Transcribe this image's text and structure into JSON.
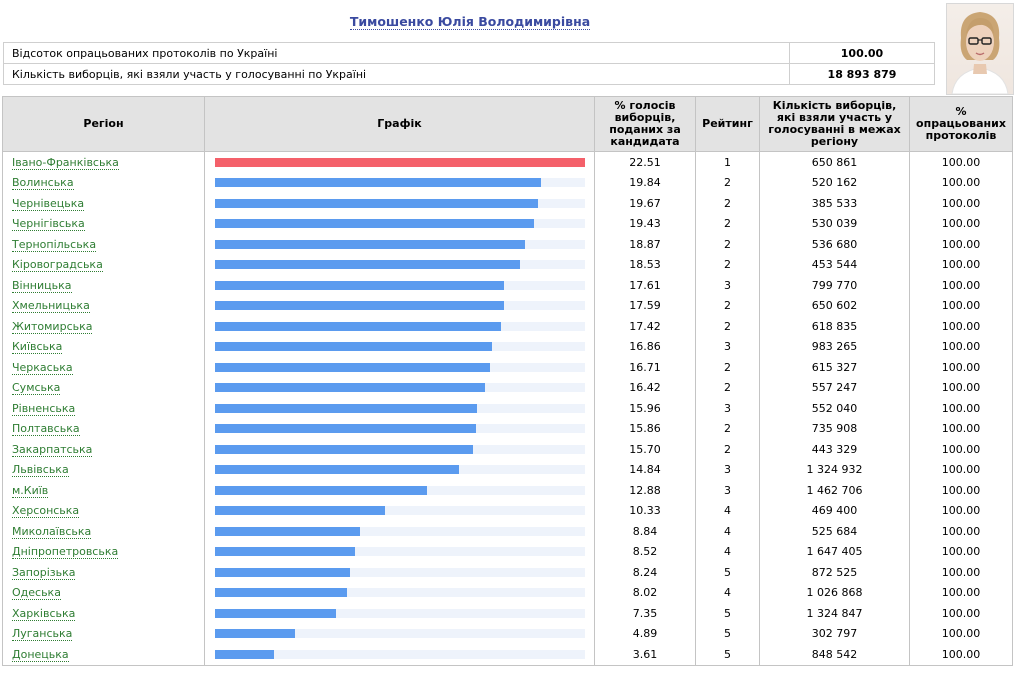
{
  "candidate": {
    "name": "Тимошенко Юлія Володимирівна"
  },
  "summary": [
    {
      "label": "Відсоток опрацьованих протоколів по Україні",
      "value": "100.00"
    },
    {
      "label": "Кількість виборців, які взяли участь у голосуванні по Україні",
      "value": "18 893 879"
    }
  ],
  "table": {
    "headers": {
      "region": "Регіон",
      "chart": "Графік",
      "percent": "% голосів виборців, поданих за кандидата",
      "rating": "Рейтинг",
      "voters": "Кількість виборців, які взяли участь у голосуванні в межах регіону",
      "processed": "% опрацьованих протоколів"
    },
    "rows": [
      {
        "region": "Івано-Франківська",
        "percent": "22.51",
        "rating": "1",
        "voters": "650 861",
        "processed": "100.00"
      },
      {
        "region": "Волинська",
        "percent": "19.84",
        "rating": "2",
        "voters": "520 162",
        "processed": "100.00"
      },
      {
        "region": "Чернівецька",
        "percent": "19.67",
        "rating": "2",
        "voters": "385 533",
        "processed": "100.00"
      },
      {
        "region": "Чернігівська",
        "percent": "19.43",
        "rating": "2",
        "voters": "530 039",
        "processed": "100.00"
      },
      {
        "region": "Тернопільська",
        "percent": "18.87",
        "rating": "2",
        "voters": "536 680",
        "processed": "100.00"
      },
      {
        "region": "Кіровоградська",
        "percent": "18.53",
        "rating": "2",
        "voters": "453 544",
        "processed": "100.00"
      },
      {
        "region": "Вінницька",
        "percent": "17.61",
        "rating": "3",
        "voters": "799 770",
        "processed": "100.00"
      },
      {
        "region": "Хмельницька",
        "percent": "17.59",
        "rating": "2",
        "voters": "650 602",
        "processed": "100.00"
      },
      {
        "region": "Житомирська",
        "percent": "17.42",
        "rating": "2",
        "voters": "618 835",
        "processed": "100.00"
      },
      {
        "region": "Київська",
        "percent": "16.86",
        "rating": "3",
        "voters": "983 265",
        "processed": "100.00"
      },
      {
        "region": "Черкаська",
        "percent": "16.71",
        "rating": "2",
        "voters": "615 327",
        "processed": "100.00"
      },
      {
        "region": "Сумська",
        "percent": "16.42",
        "rating": "2",
        "voters": "557 247",
        "processed": "100.00"
      },
      {
        "region": "Рівненська",
        "percent": "15.96",
        "rating": "3",
        "voters": "552 040",
        "processed": "100.00"
      },
      {
        "region": "Полтавська",
        "percent": "15.86",
        "rating": "2",
        "voters": "735 908",
        "processed": "100.00"
      },
      {
        "region": "Закарпатська",
        "percent": "15.70",
        "rating": "2",
        "voters": "443 329",
        "processed": "100.00"
      },
      {
        "region": "Львівська",
        "percent": "14.84",
        "rating": "3",
        "voters": "1 324 932",
        "processed": "100.00"
      },
      {
        "region": "м.Київ",
        "percent": "12.88",
        "rating": "3",
        "voters": "1 462 706",
        "processed": "100.00"
      },
      {
        "region": "Херсонська",
        "percent": "10.33",
        "rating": "4",
        "voters": "469 400",
        "processed": "100.00"
      },
      {
        "region": "Миколаївська",
        "percent": "8.84",
        "rating": "4",
        "voters": "525 684",
        "processed": "100.00"
      },
      {
        "region": "Дніпропетровська",
        "percent": "8.52",
        "rating": "4",
        "voters": "1 647 405",
        "processed": "100.00"
      },
      {
        "region": "Запорізька",
        "percent": "8.24",
        "rating": "5",
        "voters": "872 525",
        "processed": "100.00"
      },
      {
        "region": "Одеська",
        "percent": "8.02",
        "rating": "4",
        "voters": "1 026 868",
        "processed": "100.00"
      },
      {
        "region": "Харківська",
        "percent": "7.35",
        "rating": "5",
        "voters": "1 324 847",
        "processed": "100.00"
      },
      {
        "region": "Луганська",
        "percent": "4.89",
        "rating": "5",
        "voters": "302 797",
        "processed": "100.00"
      },
      {
        "region": "Донецька",
        "percent": "3.61",
        "rating": "5",
        "voters": "848 542",
        "processed": "100.00"
      }
    ]
  },
  "colors": {
    "bar": "#5b9bef",
    "bar_top": "#f4606a",
    "bar_track": "#eef3fb",
    "link": "#2e7d32",
    "title": "#3a4aa0"
  }
}
